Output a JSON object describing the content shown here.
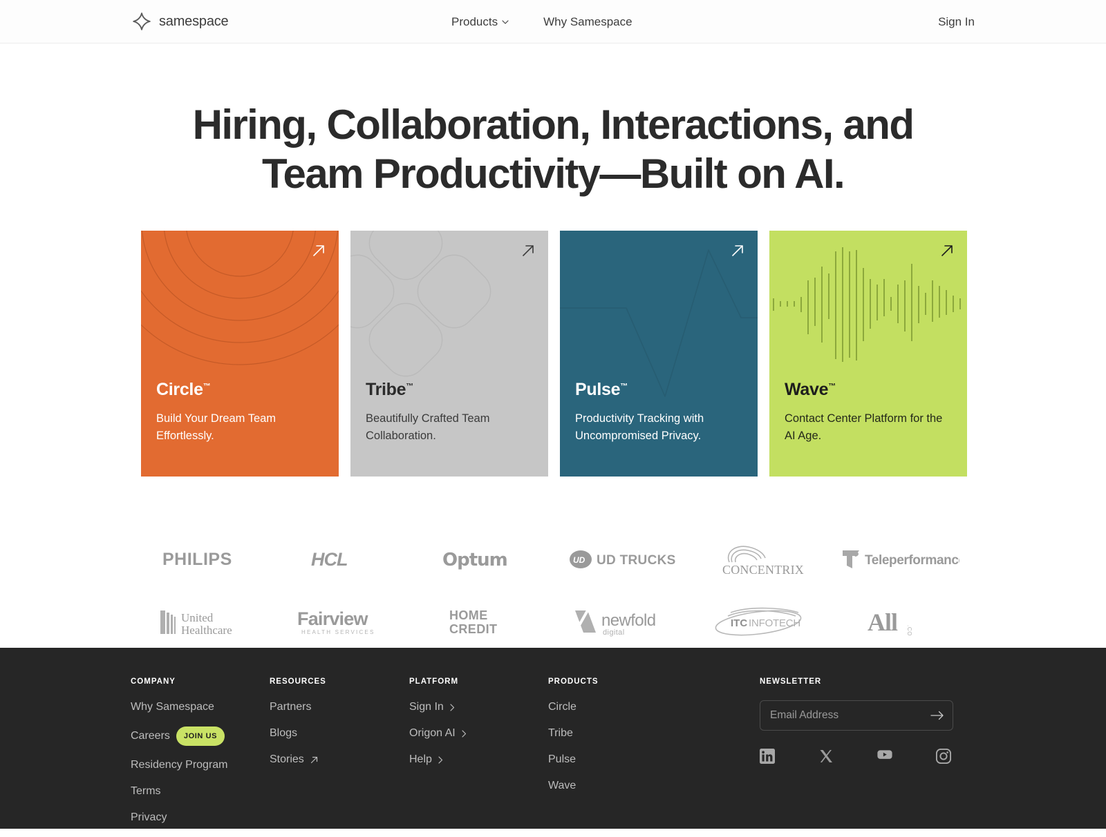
{
  "header": {
    "brand": "samespace",
    "logo_icon": "four-point-star-icon",
    "nav": [
      {
        "label": "Products",
        "has_chevron": true
      },
      {
        "label": "Why Samespace",
        "has_chevron": false
      }
    ],
    "signin_label": "Sign In"
  },
  "hero": {
    "line1": "Hiring, Collaboration, Interactions, and",
    "line2": "Team Productivity—Built on AI."
  },
  "cards": [
    {
      "name": "Circle",
      "tm": "™",
      "desc": "Build Your Dream Team Effortlessly.",
      "color": "#E26B31",
      "art": "concentric-rings"
    },
    {
      "name": "Tribe",
      "tm": "™",
      "desc": "Beautifully Crafted Team Collaboration.",
      "color": "#C6C6C6",
      "art": "squircle-cluster"
    },
    {
      "name": "Pulse",
      "tm": "™",
      "desc": "Productivity Tracking with Uncompromised Privacy.",
      "color": "#2A657C",
      "art": "heartbeat-line"
    },
    {
      "name": "Wave",
      "tm": "™",
      "desc": "Contact Center Platform for the AI Age.",
      "color": "#C3DF61",
      "art": "audio-waveform"
    }
  ],
  "logos": [
    "PHILIPS",
    "HCL",
    "Optum",
    "UD TRUCKS",
    "CONCENTRIX",
    "Teleperformance",
    "United Healthcare",
    "Fairview HEALTH SERVICES",
    "HOME CREDIT",
    "newfold digital",
    "ITC INFOTECH",
    "All .COM"
  ],
  "footer": {
    "columns": [
      {
        "title": "COMPANY",
        "links": [
          {
            "label": "Why Samespace"
          },
          {
            "label": "Careers",
            "badge": "JOIN US"
          },
          {
            "label": "Residency Program"
          },
          {
            "label": "Terms"
          },
          {
            "label": "Privacy"
          }
        ]
      },
      {
        "title": "RESOURCES",
        "links": [
          {
            "label": "Partners"
          },
          {
            "label": "Blogs"
          },
          {
            "label": "Stories",
            "icon": "arrow-up-right-icon"
          }
        ]
      },
      {
        "title": "PLATFORM",
        "links": [
          {
            "label": "Sign In",
            "icon": "chevron-right-icon"
          },
          {
            "label": "Origon AI",
            "icon": "chevron-right-icon"
          },
          {
            "label": "Help",
            "icon": "chevron-right-icon"
          }
        ]
      },
      {
        "title": "PRODUCTS",
        "links": [
          {
            "label": "Circle"
          },
          {
            "label": "Tribe"
          },
          {
            "label": "Pulse"
          },
          {
            "label": "Wave"
          }
        ]
      }
    ],
    "newsletter": {
      "title": "NEWSLETTER",
      "placeholder": "Email Address",
      "value": "",
      "submit_icon": "arrow-right-icon"
    },
    "socials": [
      {
        "name": "linkedin-icon"
      },
      {
        "name": "x-twitter-icon"
      },
      {
        "name": "youtube-icon"
      },
      {
        "name": "instagram-icon"
      }
    ],
    "accent_badge_color": "#C9E265",
    "background": "#262626"
  }
}
